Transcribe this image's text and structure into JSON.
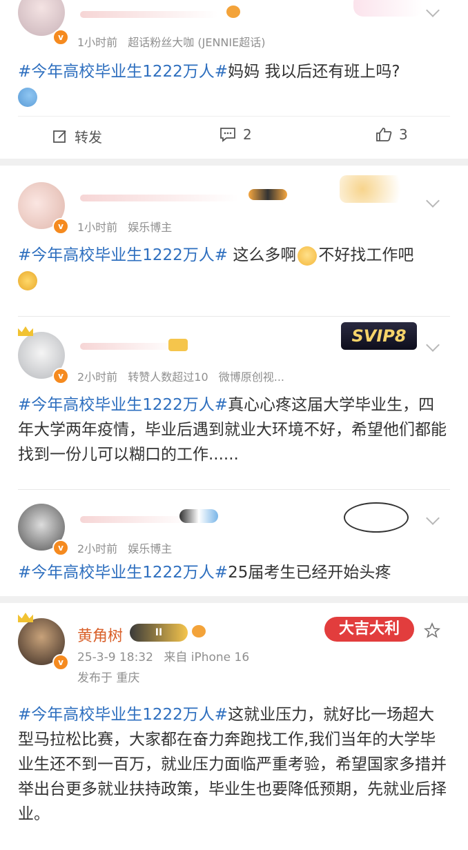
{
  "posts": [
    {
      "time": "1小时前",
      "source": "超话粉丝大咖 (JENNIE超话)",
      "hashtag": "#今年高校毕业生1222万人#",
      "text": "妈妈 我以后还有班上吗?",
      "actions": {
        "repost": "转发",
        "comments": "2",
        "likes": "3"
      }
    },
    {
      "time": "1小时前",
      "source": "娱乐博主",
      "hashtag": "#今年高校毕业生1222万人#",
      "text_a": " 这么多啊",
      "text_b": "不好找工作吧"
    },
    {
      "time": "2小时前",
      "source": "转赞人数超过10",
      "source2": "微博原创视...",
      "badge": "SVIP8",
      "hashtag": "#今年高校毕业生1222万人#",
      "text": "真心心疼这届大学毕业生，四年大学两年疫情，毕业后遇到就业大环境不好，希望他们都能找到一份儿可以糊口的工作......"
    },
    {
      "time": "2小时前",
      "source": "娱乐博主",
      "hashtag": "#今年高校毕业生1222万人#",
      "text": "25届考生已经开始头疼"
    },
    {
      "name": "黄角树",
      "level": "II",
      "badge": "大吉大利",
      "time": "25-3-9 18:32",
      "source": "来自 iPhone 16",
      "location": "发布于 重庆",
      "hashtag": "#今年高校毕业生1222万人#",
      "text": "这就业压力，就好比一场超大型马拉松比赛，大家都在奋力奔跑找工作,我们当年的大学毕业生还不到一百万，就业压力面临严重考验，希望国家多措并举出台更多就业扶持政策，毕业生也要降低预期，先就业后择业。"
    }
  ],
  "colors": {
    "hashtag": "#2e6fbf",
    "name": "#d9602a",
    "verified": "#f58a1f"
  }
}
